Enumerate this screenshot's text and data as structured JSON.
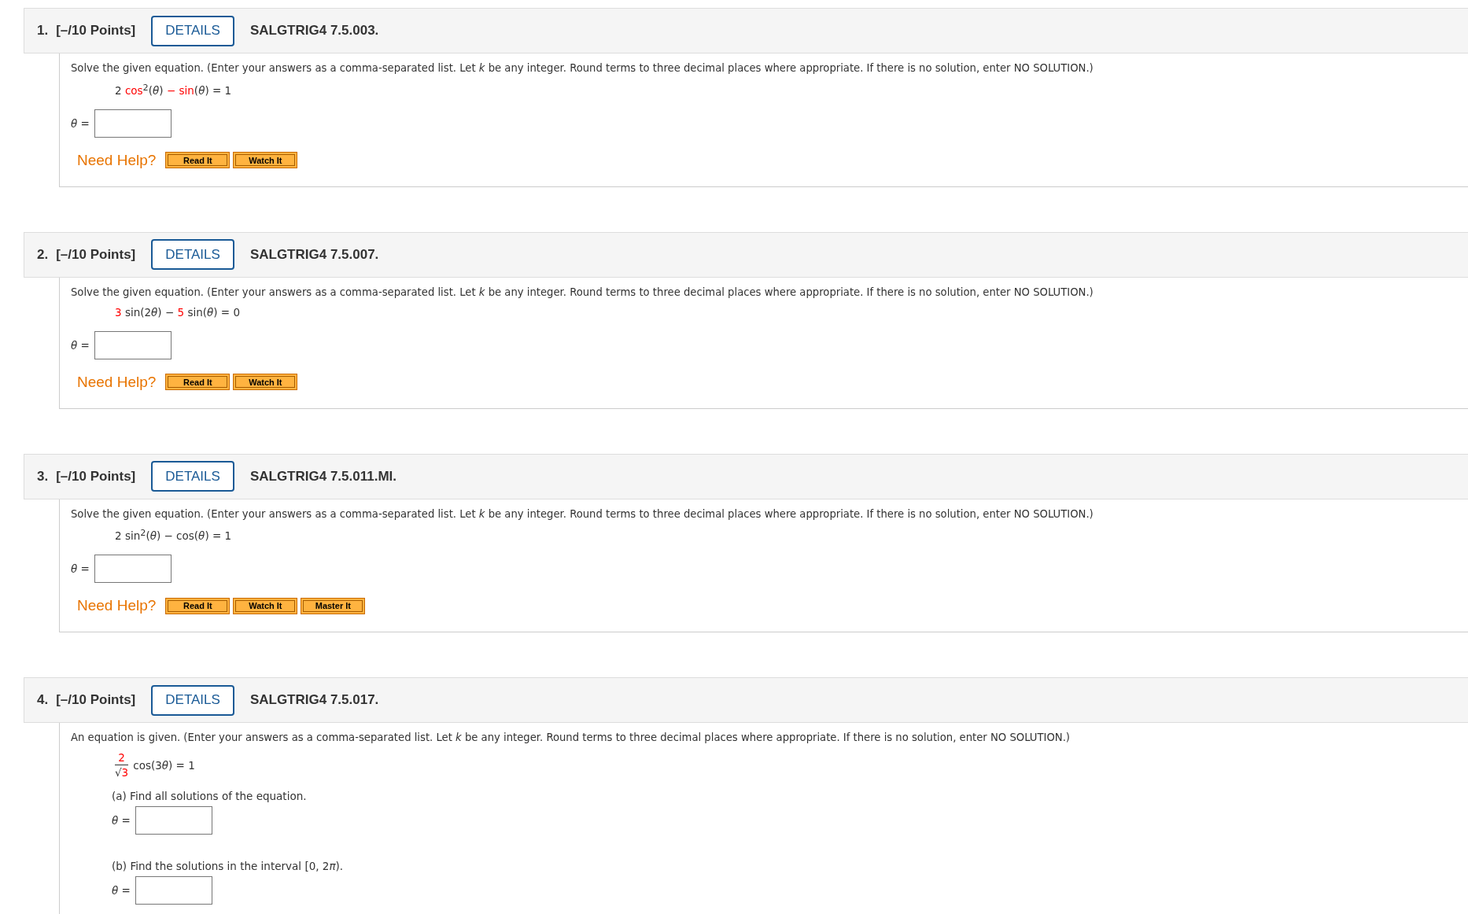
{
  "questions": [
    {
      "number": "1.",
      "points": "[–/10 Points]",
      "details_button": "DETAILS",
      "code": "SALGTRIG4 7.5.003.",
      "prompt": "Solve the given equation. (Enter your answers as a comma-separated list. Let *k* be any integer. Round terms to three decimal places where appropriate. If there is no solution, enter NO SOLUTION.)",
      "equation": {
        "kind": "inline",
        "segments": [
          {
            "text": "2 ",
            "highlighted": false
          },
          {
            "text": "cos",
            "highlighted": true
          },
          {
            "text": "$^{2}$(*θ*) ",
            "highlighted": false
          },
          {
            "text": "− sin",
            "highlighted": true
          },
          {
            "text": "(*θ*) = 1",
            "highlighted": false
          }
        ]
      },
      "answers": [
        {
          "label": "*θ* ="
        }
      ],
      "help": {
        "label": "Need Help?",
        "buttons": [
          "Read It",
          "Watch It"
        ]
      }
    },
    {
      "number": "2.",
      "points": "[–/10 Points]",
      "details_button": "DETAILS",
      "code": "SALGTRIG4 7.5.007.",
      "prompt": "Solve the given equation. (Enter your answers as a comma-separated list. Let *k* be any integer. Round terms to three decimal places where appropriate. If there is no solution, enter NO SOLUTION.)",
      "equation": {
        "kind": "inline",
        "segments": [
          {
            "text": "3",
            "highlighted": true
          },
          {
            "text": " sin(2",
            "highlighted": false
          },
          {
            "text": "*θ*) − ",
            "highlighted": false
          },
          {
            "text": "5",
            "highlighted": true
          },
          {
            "text": " sin(*θ*) = 0",
            "highlighted": false
          }
        ]
      },
      "answers": [
        {
          "label": "*θ* ="
        }
      ],
      "help": {
        "label": "Need Help?",
        "buttons": [
          "Read It",
          "Watch It"
        ]
      }
    },
    {
      "number": "3.",
      "points": "[–/10 Points]",
      "details_button": "DETAILS",
      "code": "SALGTRIG4 7.5.011.MI.",
      "prompt": "Solve the given equation. (Enter your answers as a comma-separated list. Let *k* be any integer. Round terms to three decimal places where appropriate. If there is no solution, enter NO SOLUTION.)",
      "equation": {
        "kind": "inline",
        "segments": [
          {
            "text": "2 sin$^{2}$(*θ*) − cos(*θ*) = 1",
            "highlighted": false
          }
        ]
      },
      "answers": [
        {
          "label": "*θ* ="
        }
      ],
      "help": {
        "label": "Need Help?",
        "buttons": [
          "Read It",
          "Watch It",
          "Master It"
        ]
      }
    },
    {
      "number": "4.",
      "points": "[–/10 Points]",
      "details_button": "DETAILS",
      "code": "SALGTRIG4 7.5.017.",
      "prompt": "An equation is given. (Enter your answers as a comma-separated list. Let *k* be any integer. Round terms to three decimal places where appropriate. If there is no solution, enter NO SOLUTION.)",
      "equation": {
        "kind": "fraction",
        "numerator": [
          {
            "text": "2",
            "highlighted": true
          }
        ],
        "denominator": [
          {
            "text": "√",
            "highlighted": false
          },
          {
            "text": "3",
            "highlighted": true
          }
        ],
        "segments": [
          {
            "text": "cos(3",
            "highlighted": false
          },
          {
            "text": "*θ*) = 1",
            "highlighted": false
          }
        ]
      },
      "parts": [
        {
          "prompt": [
            "(a) Find all solutions of the equation."
          ],
          "label": "*θ* ="
        },
        {
          "prompt": [
            "(b) Find the solutions in the interval [0, 2",
            "*π*)."
          ],
          "label": "*θ* ="
        }
      ]
    }
  ]
}
